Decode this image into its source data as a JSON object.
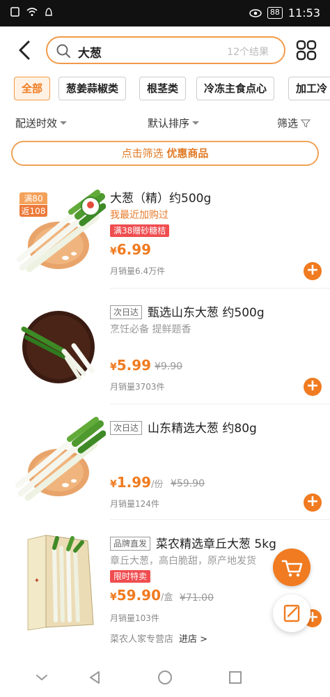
{
  "status": {
    "left_icons": [
      "sim-icon",
      "wifi-icon",
      "notification-icon"
    ],
    "battery": "88",
    "time": "11:53"
  },
  "search": {
    "query": "大葱",
    "result_count": "12个结果"
  },
  "categories": [
    {
      "label": "全部",
      "active": true
    },
    {
      "label": "葱姜蒜椒类"
    },
    {
      "label": "根茎类"
    },
    {
      "label": "冷冻主食点心"
    },
    {
      "label": "加工冷"
    }
  ],
  "sort": {
    "delivery": "配送时效",
    "default": "默认排序",
    "filter": "筛选"
  },
  "promo": {
    "text": "点击筛选 ",
    "bold": "优惠商品"
  },
  "products": [
    {
      "title": "大葱（精）约500g",
      "subtitle": "我最近加购过",
      "tag": "满38赠砂糖桔",
      "price_symbol": "¥",
      "price": "6.99",
      "sales": "月销量6.4万件",
      "badge_top": "满80",
      "badge_bottom": "返108"
    },
    {
      "box_tag": "次日达",
      "title": "甄选山东大葱 约500g",
      "subtitle": "烹饪必备 提鲜题香",
      "price_symbol": "¥",
      "price": "5.99",
      "old_price": "¥9.90",
      "sales": "月销量3703件"
    },
    {
      "box_tag": "次日达",
      "title": "山东精选大葱 约80g",
      "price_symbol": "¥",
      "price": "1.99",
      "unit": "/份",
      "old_price": "¥59.90",
      "sales": "月销量124件"
    },
    {
      "box_tag": "品牌直发",
      "title": "菜农精选章丘大葱 5kg",
      "subtitle": "章丘大葱，高白脆甜，原产地发货",
      "tag": "限时特卖",
      "price_symbol": "¥",
      "price": "59.90",
      "unit": "/盒",
      "old_price": "¥71.00",
      "sales": "月销量103件",
      "store": "菜农人家专营店",
      "store_link": "进店 >"
    }
  ],
  "colors": {
    "accent": "#f07b20",
    "red_tag": "#ef4d50"
  }
}
